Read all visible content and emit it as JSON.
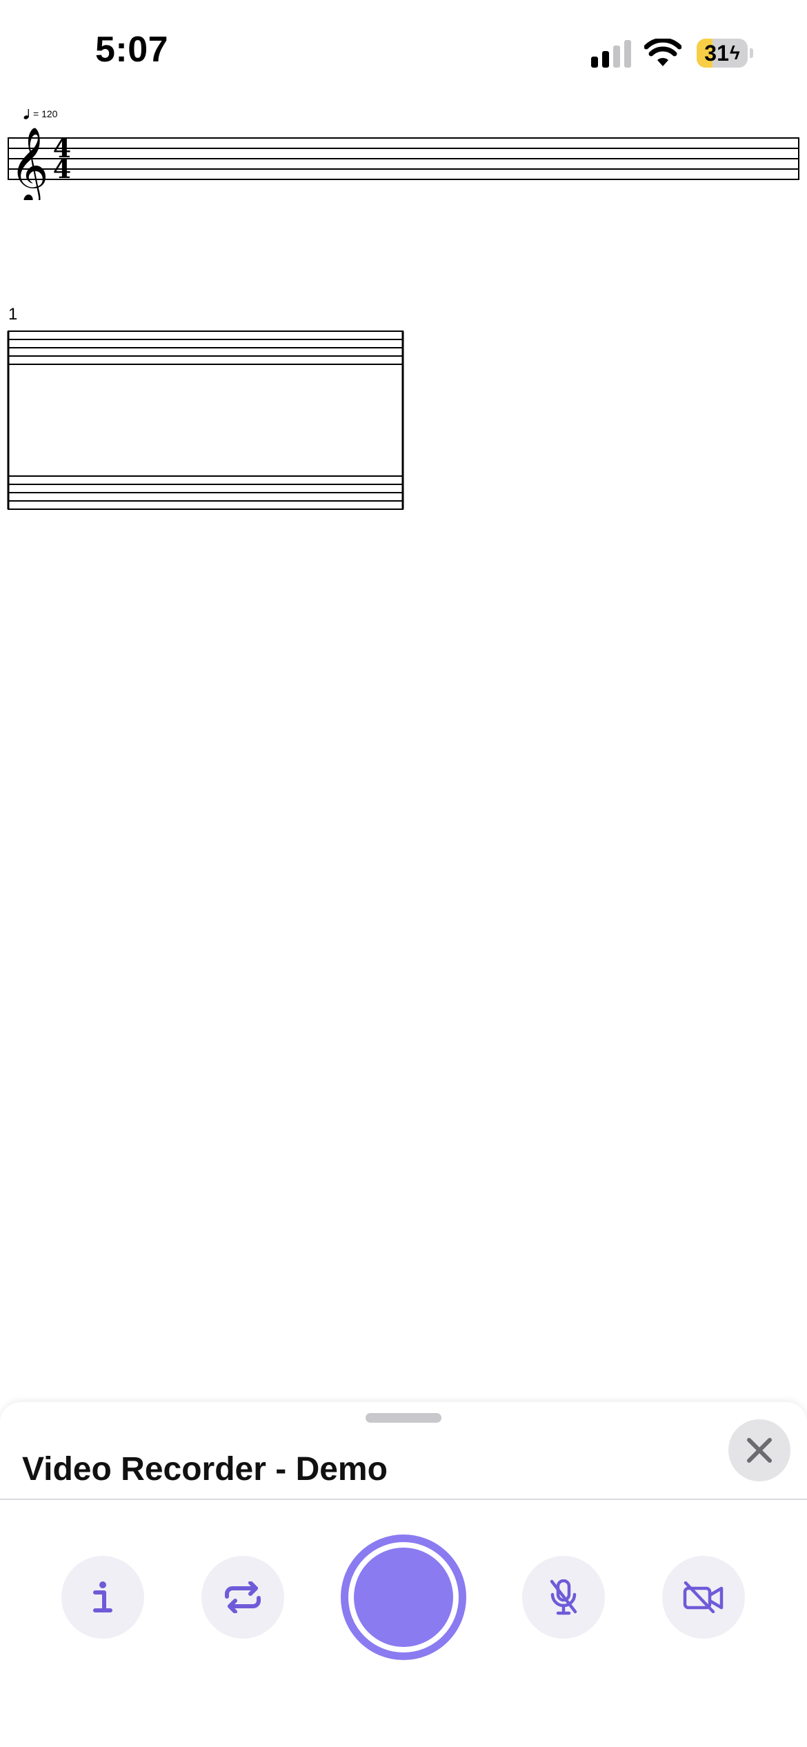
{
  "status_bar": {
    "time": "5:07",
    "battery_percent": 31,
    "battery_label": "31",
    "charging": true,
    "signal_bars_active": 2,
    "signal_bars_total": 4
  },
  "score": {
    "tempo_label": "= 120",
    "tempo_note_icon": "quarter-note-icon",
    "clef": "treble-clef",
    "time_signature_top": "4",
    "time_signature_bottom": "4",
    "measure_number": "1"
  },
  "recorder": {
    "title": "Video Recorder - Demo",
    "close_icon": "close-icon",
    "buttons": [
      {
        "name": "info-button",
        "icon": "info-icon"
      },
      {
        "name": "loop-button",
        "icon": "repeat-icon"
      },
      {
        "name": "record-button",
        "icon": "record-icon"
      },
      {
        "name": "mic-toggle-button",
        "icon": "mic-off-icon"
      },
      {
        "name": "camera-toggle-button",
        "icon": "video-off-icon"
      }
    ]
  },
  "colors": {
    "accent": "#8A7BF1",
    "icon_accent": "#6E5BD8",
    "button_bg": "#F0EFF5",
    "close_bg": "#E4E4E7",
    "battery_fill": "#F7CE46"
  }
}
